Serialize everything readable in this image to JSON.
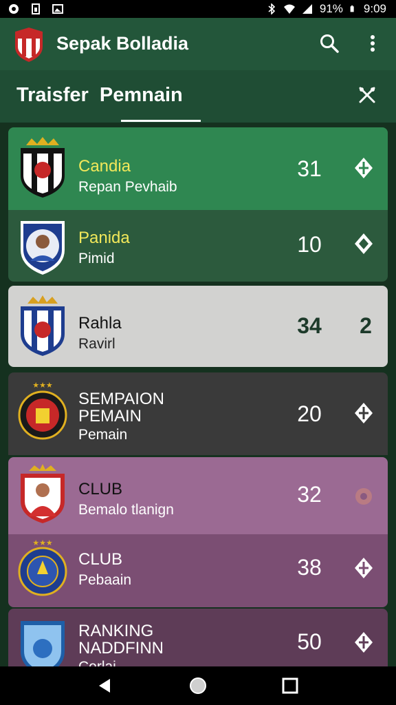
{
  "status_bar": {
    "battery": "91%",
    "time": "9:09",
    "icons": [
      "sync-icon",
      "sim-icon",
      "image-icon",
      "bluetooth-icon",
      "wifi-icon",
      "signal-icon",
      "battery-icon"
    ]
  },
  "app_bar": {
    "title": "Sepak Bolladia",
    "icons": [
      "club-logo-icon",
      "search-icon",
      "more-vert-icon"
    ]
  },
  "sub_header": {
    "title": "Traisfer  Pemnain",
    "icons": [
      "tools-icon"
    ]
  },
  "players": [
    {
      "name": "Candia",
      "subtitle": "Repan Pevhaib",
      "number": "31",
      "action_icon": "diamond-icon",
      "bg": "#2f8751",
      "name_color": "#f2e85a",
      "sub_color": "#ffffff",
      "num_color": "#ffffff"
    },
    {
      "name": "Panida",
      "subtitle": "Pimid",
      "number": "10",
      "action_icon": "diamond-outline-icon",
      "bg": "#2c5a3d",
      "name_color": "#f2e85a",
      "sub_color": "#ffffff",
      "num_color": "#ffffff"
    },
    {
      "name": "Rahla",
      "subtitle": "Ravirl",
      "number": "34",
      "action_label": "2",
      "bg": "#d2d2d0",
      "name_color": "#111111",
      "sub_color": "#222222",
      "num_color": "#1d3a2a"
    },
    {
      "name": "SEMPAION PEMAIN",
      "subtitle": "Pemain",
      "number": "20",
      "action_icon": "diamond-icon",
      "bg": "#3a3a3a",
      "name_color": "#ffffff",
      "sub_color": "#ffffff",
      "num_color": "#ffffff"
    },
    {
      "name": "CLUB",
      "subtitle": "Bemalo tlanign",
      "number": "32",
      "action_icon": "ball-icon",
      "bg": "#9b6a93",
      "name_color": "#111111",
      "sub_color": "#ffffff",
      "num_color": "#ffffff"
    },
    {
      "name": "CLUB",
      "subtitle": "Pebaain",
      "number": "38",
      "action_icon": "diamond-icon",
      "bg": "#7b4e73",
      "name_color": "#ffffff",
      "sub_color": "#ffffff",
      "num_color": "#ffffff"
    },
    {
      "name": "RANKING NADDFINN",
      "subtitle": "Corlai",
      "number": "50",
      "action_icon": "diamond-icon",
      "bg": "#5e3c57",
      "name_color": "#ffffff",
      "sub_color": "#ffffff",
      "num_color": "#ffffff"
    }
  ],
  "nav_bar": {
    "icons": [
      "back-icon",
      "home-icon",
      "recents-icon"
    ]
  }
}
